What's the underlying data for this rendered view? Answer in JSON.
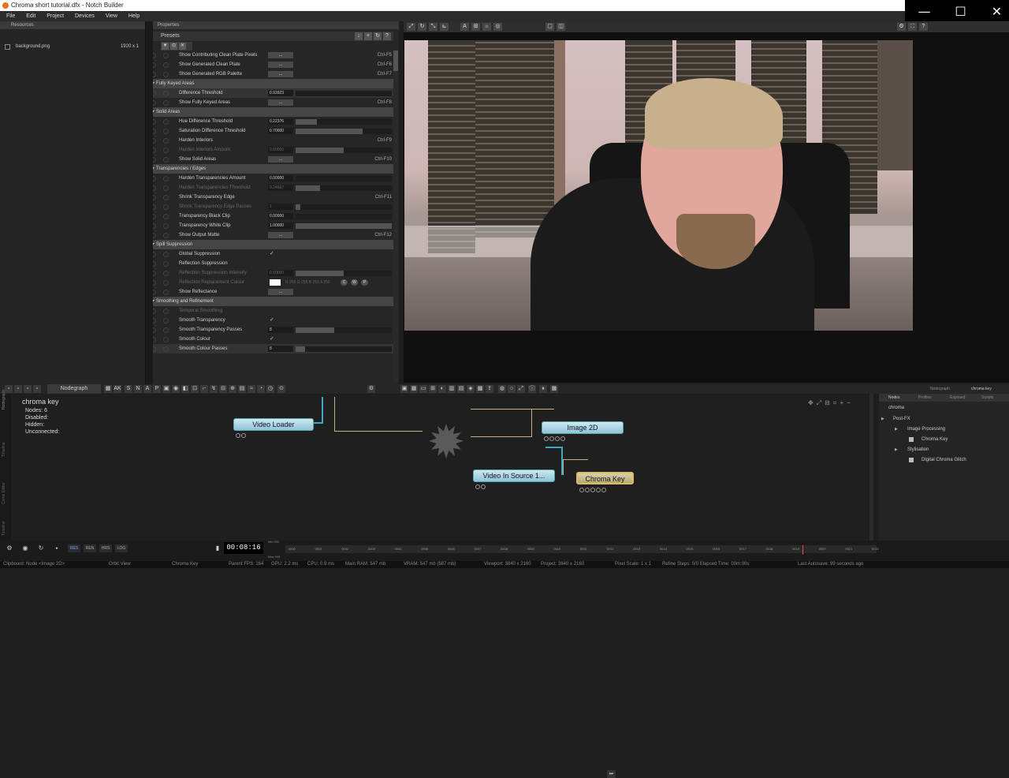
{
  "window": {
    "title": "Chroma short tutorial.dfx - Notch Builder",
    "minimize": "—",
    "maximize": "☐",
    "close": "✕"
  },
  "menu": [
    "File",
    "Edit",
    "Project",
    "Devices",
    "View",
    "Help"
  ],
  "resources": {
    "header": "Resources",
    "items": [
      {
        "name": "background.png",
        "size": "1920 x 1"
      }
    ]
  },
  "properties": {
    "header": "Properties",
    "presets_label": "Presets",
    "preset_tools": [
      "↓",
      "+",
      "↻",
      "♥",
      "?"
    ],
    "filter_tools": [
      "▼",
      "⊙",
      "✕"
    ],
    "rows": [
      {
        "type": "prop",
        "label": "Show Contributing Clean Plate Pixels",
        "ctrl": "button",
        "btn": "...",
        "shortcut": "Ctrl-F5"
      },
      {
        "type": "prop",
        "label": "Show Generated Clean Plate",
        "ctrl": "button",
        "btn": "...",
        "shortcut": "Ctrl-F6"
      },
      {
        "type": "prop",
        "label": "Show Generated RGB Palette",
        "ctrl": "button",
        "btn": "...",
        "shortcut": "Ctrl-F7"
      },
      {
        "type": "section",
        "label": "Fully Keyed Areas"
      },
      {
        "type": "prop",
        "label": "Difference Threshold",
        "ctrl": "slider",
        "value": "0.93923",
        "fill": 0,
        "hl": true
      },
      {
        "type": "prop",
        "label": "Show Fully Keyed Areas",
        "ctrl": "button",
        "btn": "...",
        "shortcut": "Ctrl-F8"
      },
      {
        "type": "section",
        "label": "Solid Areas"
      },
      {
        "type": "prop",
        "label": "Hue Difference Threshold",
        "ctrl": "slider",
        "value": "0.22376",
        "fill": 22
      },
      {
        "type": "prop",
        "label": "Saturation Difference Threshold",
        "ctrl": "slider",
        "value": "0.70000",
        "fill": 70
      },
      {
        "type": "prop",
        "label": "Harden Interiors",
        "ctrl": "check",
        "check": "",
        "shortcut": "Ctrl-F9"
      },
      {
        "type": "prop",
        "label": "Harden Interiors Amount",
        "ctrl": "slider",
        "value": "0.50000",
        "fill": 50,
        "dim": true
      },
      {
        "type": "prop",
        "label": "Show Solid Areas",
        "ctrl": "button",
        "btn": "...",
        "shortcut": "Ctrl-F10"
      },
      {
        "type": "section",
        "label": "Transparencies / Edges"
      },
      {
        "type": "prop",
        "label": "Harden Transparencies Amount",
        "ctrl": "slider",
        "value": "0.00000",
        "fill": 0
      },
      {
        "type": "prop",
        "label": "Harden Transparencies Threshold",
        "ctrl": "slider",
        "value": "0.24667",
        "fill": 25,
        "dim": true
      },
      {
        "type": "prop",
        "label": "Shrink Transparency Edge",
        "ctrl": "check",
        "check": "",
        "shortcut": "Ctrl-F11"
      },
      {
        "type": "prop",
        "label": "Shrink Transparency Edge Passes",
        "ctrl": "slider",
        "value": "1",
        "fill": 5,
        "dim": true
      },
      {
        "type": "prop",
        "label": "Transparency Black Clip",
        "ctrl": "slider",
        "value": "0.00000",
        "fill": 0
      },
      {
        "type": "prop",
        "label": "Transparency White Clip",
        "ctrl": "slider",
        "value": "1.00000",
        "fill": 100
      },
      {
        "type": "prop",
        "label": "Show Output Matte",
        "ctrl": "button",
        "btn": "...",
        "shortcut": "Ctrl-F12"
      },
      {
        "type": "section",
        "label": "Spill Suppression"
      },
      {
        "type": "prop",
        "label": "Global Suppression",
        "ctrl": "check",
        "check": "✓"
      },
      {
        "type": "prop",
        "label": "Reflection Suppression",
        "ctrl": "check",
        "check": ""
      },
      {
        "type": "prop",
        "label": "Reflection Suppression Intensity",
        "ctrl": "slider",
        "value": "0.50000",
        "fill": 50,
        "dim": true
      },
      {
        "type": "prop",
        "label": "Reflection Replacement Colour",
        "ctrl": "colour",
        "rgb": "R 255 G 255 B 255 A 255",
        "dim": true,
        "swatch": [
          "C",
          "W",
          "P"
        ]
      },
      {
        "type": "prop",
        "label": "Show Reflectance",
        "ctrl": "button",
        "btn": "..."
      },
      {
        "type": "section",
        "label": "Smoothing and Refinement"
      },
      {
        "type": "prop",
        "label": "Temporal Smoothing",
        "ctrl": "check",
        "check": "",
        "dim": true
      },
      {
        "type": "prop",
        "label": "Smooth Transparency",
        "ctrl": "check",
        "check": "✓"
      },
      {
        "type": "prop",
        "label": "Smooth Transparency Passes",
        "ctrl": "slider",
        "value": "8",
        "fill": 40
      },
      {
        "type": "prop",
        "label": "Smooth Colour",
        "ctrl": "check",
        "check": "✓"
      },
      {
        "type": "prop",
        "label": "Smooth Colour Passes",
        "ctrl": "slider",
        "value": "8",
        "fill": 10,
        "hl": true
      }
    ]
  },
  "nodegraph": {
    "tab_label": "Nodegraph",
    "toolbar_letters": [
      "AK",
      "S",
      "N",
      "A",
      "P"
    ],
    "side_tabs": [
      "Nodegraph",
      "Timeline",
      "Curve Editor",
      "Timeline"
    ],
    "info": {
      "title": "chroma key",
      "lines": [
        "Nodes: 6",
        "Disabled:",
        "Hidden:",
        "Unconnected:"
      ]
    },
    "nodes": {
      "video_loader": "Video Loader",
      "image_2d": "Image 2D",
      "video_in_source": "Video In Source 1...",
      "chroma_key": "Chroma Key"
    }
  },
  "nodes_panel": {
    "tabs": [
      "Nodes",
      "Profiles",
      "Exposed",
      "Scripts"
    ],
    "search_value": "chroma",
    "tree": [
      {
        "label": "Post-FX",
        "level": 0,
        "kind": "arrow"
      },
      {
        "label": "Image Processing",
        "level": 1,
        "kind": "arrow"
      },
      {
        "label": "Chroma Key",
        "level": 2,
        "kind": "item"
      },
      {
        "label": "Stylisation",
        "level": 1,
        "kind": "arrow"
      },
      {
        "label": "Digital Chroma Glitch",
        "level": 2,
        "kind": "item"
      }
    ],
    "top_labels": [
      "Nodegraph",
      "chroma key"
    ]
  },
  "timeline": {
    "timecode": "00:08:16",
    "buttons": [
      "RES",
      "REN",
      "HRS",
      "LOG"
    ],
    "min_max": [
      "Min 000",
      "Max 999"
    ],
    "ticks": [
      "0000",
      "0001",
      "0002",
      "0003",
      "0004",
      "0005",
      "0006",
      "0007",
      "0008",
      "0009",
      "0010",
      "0011",
      "0012",
      "0013",
      "0014",
      "0015",
      "0016",
      "0017",
      "0018",
      "0019",
      "0020",
      "0021",
      "0022"
    ]
  },
  "status": {
    "clipboard": "Clipboard: Node <Image 2D>",
    "view": "Orbit View",
    "node": "Chroma Key",
    "fps": "Parent FPS: 164",
    "gpu": "GPU: 2.2 ms",
    "cpu": "CPU: 0.9 ms",
    "ram": "Main RAM: 547 mb",
    "vram": "VRAM: 547 mb (587 mb)",
    "viewport": "Viewport: 3840 x 2160",
    "project": "Project: 3840 x 2160",
    "pixel_scale": "Pixel Scale: 1 x 1",
    "refine": "Refine Steps: 0/0  Elapsed Time: 00m:00s",
    "autosave": "Last Autosave: 99 seconds ago"
  },
  "colors": {
    "accent_node": "#8fc4d8",
    "selected_node": "#d9b96a",
    "wire": "#c9b17f"
  }
}
